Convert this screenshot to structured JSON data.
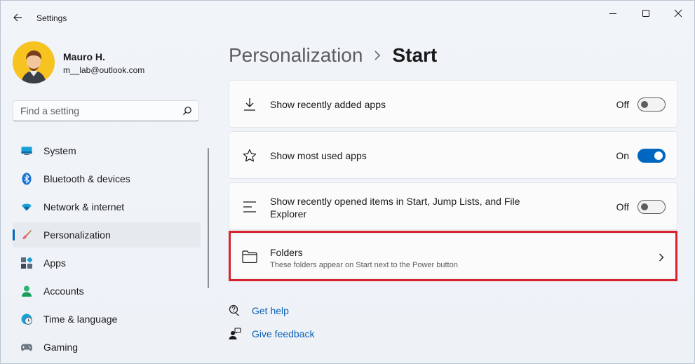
{
  "window": {
    "title": "Settings"
  },
  "user": {
    "name": "Mauro H.",
    "email": "m__lab@outlook.com"
  },
  "search": {
    "placeholder": "Find a setting"
  },
  "nav": [
    {
      "label": "System",
      "icon": "monitor-icon"
    },
    {
      "label": "Bluetooth & devices",
      "icon": "bluetooth-icon"
    },
    {
      "label": "Network & internet",
      "icon": "wifi-icon"
    },
    {
      "label": "Personalization",
      "icon": "brush-icon",
      "active": true
    },
    {
      "label": "Apps",
      "icon": "apps-icon"
    },
    {
      "label": "Accounts",
      "icon": "person-icon"
    },
    {
      "label": "Time & language",
      "icon": "clock-globe-icon"
    },
    {
      "label": "Gaming",
      "icon": "gamepad-icon"
    }
  ],
  "breadcrumb": {
    "parent": "Personalization",
    "current": "Start"
  },
  "settings": {
    "recently_added": {
      "label": "Show recently added apps",
      "state": "Off"
    },
    "most_used": {
      "label": "Show most used apps",
      "state": "On"
    },
    "recently_opened": {
      "label": "Show recently opened items in Start, Jump Lists, and File Explorer",
      "state": "Off"
    },
    "folders": {
      "label": "Folders",
      "description": "These folders appear on Start next to the Power button"
    }
  },
  "links": {
    "help": "Get help",
    "feedback": "Give feedback"
  },
  "colors": {
    "accent": "#0067c0",
    "highlight": "#d9232c",
    "link": "#0a5fb4"
  }
}
